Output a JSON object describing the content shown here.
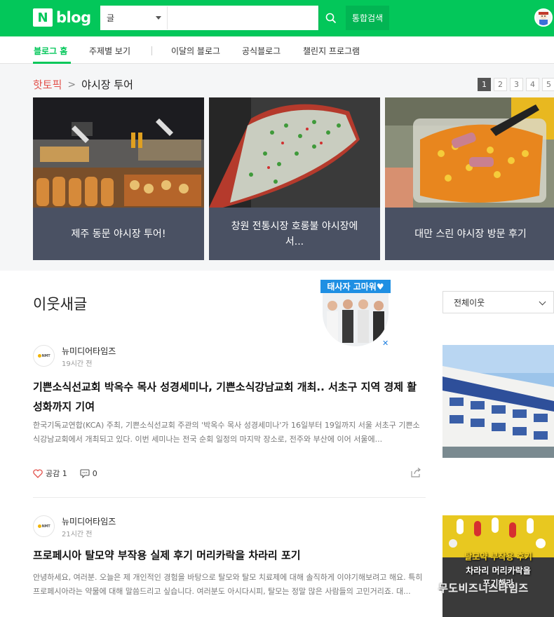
{
  "header": {
    "logo_n": "N",
    "logo_text": "blog",
    "search_select": "글",
    "search_value": "",
    "total_search_label": "통합검색"
  },
  "nav": {
    "items": [
      {
        "label": "블로그 홈",
        "active": true
      },
      {
        "label": "주제별 보기",
        "active": false
      },
      {
        "label": "이달의 블로그",
        "active": false
      },
      {
        "label": "공식블로그",
        "active": false
      },
      {
        "label": "챌린지 프로그램",
        "active": false
      }
    ]
  },
  "hot_topic": {
    "label": "핫토픽",
    "title": "야시장 투어",
    "pages": [
      "1",
      "2",
      "3",
      "4",
      "5"
    ],
    "active_page": "1",
    "cards": [
      {
        "caption": "제주 동문 야시장 투어!"
      },
      {
        "caption": "창원 전통시장 호롱불 야시장에서..."
      },
      {
        "caption": "대만 스린 야시장 방문 후기"
      }
    ]
  },
  "feed": {
    "title": "이웃새글",
    "ad_banner": "태사자 고마워♥",
    "ad_close": "✕",
    "filter_label": "전체이웃",
    "posts": [
      {
        "author": "뉴미디어타임즈",
        "time": "19시간 전",
        "title": "기쁜소식선교회 박옥수 목사 성경세미나, 기쁜소식강남교회 개최.. 서초구 지역 경제 활성화까지 기여",
        "body": "한국기독교연합(KCA) 주최, 기쁜소식선교회 주관의 '박옥수 목사 성경세미나'가 16일부터 19일까지 서울 서초구 기쁜소식강남교회에서 개최되고 있다. 이번 세미나는 전국 순회 일정의 마지막 장소로, 전주와 부산에 이어 서울에...",
        "likes_label": "공감",
        "likes": "1",
        "comments": "0"
      },
      {
        "author": "뉴미디어타임즈",
        "time": "21시간 전",
        "title": "프로페시아 탈모약 부작용 실제 후기 머리카락을 차라리 포기",
        "body": "안녕하세요, 여러분. 오늘은 제 개인적인 경험을 바탕으로 탈모와 탈모 치료제에 대해 솔직하게 이야기해보려고 해요. 특히 프로페시아라는 약물에 대해 말씀드리고 싶습니다. 여러분도 아시다시피, 탈모는 정말 많은 사람들의 고민거리죠. 대...",
        "thumb_text_1": "탈모약 부작용 후기",
        "thumb_text_2": "차라리 머리카락을",
        "thumb_text_3": "포기해라"
      }
    ],
    "watermark": "무도비즈니스타임즈"
  },
  "colors": {
    "brand_green": "#03c75a",
    "hot_red": "#e2504a",
    "caption_bg": "#4a5163"
  }
}
